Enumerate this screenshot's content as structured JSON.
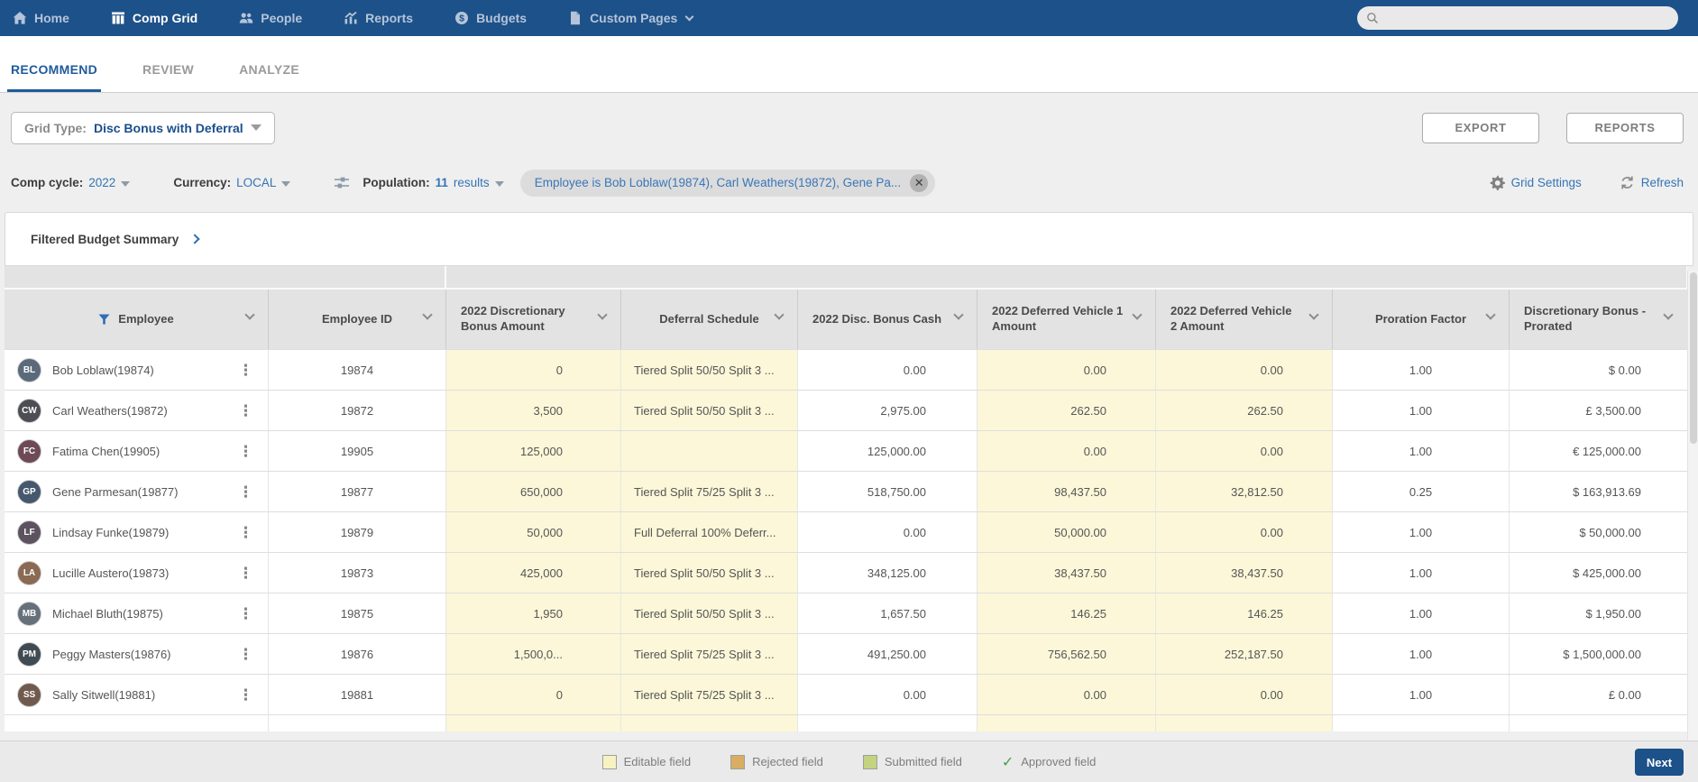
{
  "colors": {
    "nav_bg": "#1d5189",
    "accent_blue": "#3474b5",
    "active_tab": "#1f5b9d",
    "editable_cell": "#fbf7d8",
    "editable_swatch": "#f7f2c2",
    "rejected_swatch": "#d9ad62",
    "submitted_swatch": "#c3d37f",
    "approved_check": "#43a047",
    "next_btn": "#1d5189"
  },
  "nav": {
    "items": [
      {
        "label": "Home",
        "icon": "home-icon",
        "active": false
      },
      {
        "label": "Comp Grid",
        "icon": "comp-grid-icon",
        "active": true
      },
      {
        "label": "People",
        "icon": "people-icon",
        "active": false
      },
      {
        "label": "Reports",
        "icon": "reports-icon",
        "active": false
      },
      {
        "label": "Budgets",
        "icon": "budgets-icon",
        "active": false
      },
      {
        "label": "Custom Pages",
        "icon": "custom-pages-icon",
        "active": false,
        "dropdown": true
      }
    ],
    "search_value": ""
  },
  "tabs": [
    {
      "label": "RECOMMEND",
      "active": true
    },
    {
      "label": "REVIEW",
      "active": false
    },
    {
      "label": "ANALYZE",
      "active": false
    }
  ],
  "toolbar": {
    "grid_type_label": "Grid Type:",
    "grid_type_value": "Disc Bonus with Deferral",
    "export_label": "EXPORT",
    "reports_label": "REPORTS"
  },
  "filters": {
    "comp_cycle_label": "Comp cycle:",
    "comp_cycle_value": "2022",
    "currency_label": "Currency:",
    "currency_value": "LOCAL",
    "population_label": "Population:",
    "population_count": "11",
    "population_unit": "results",
    "filter_chip": "Employee is Bob Loblaw(19874), Carl Weathers(19872), Gene Pa...",
    "grid_settings_label": "Grid Settings",
    "refresh_label": "Refresh"
  },
  "summary": {
    "title": "Filtered Budget Summary"
  },
  "table": {
    "columns": [
      {
        "key": "name",
        "label": "Employee",
        "filter": true
      },
      {
        "key": "id",
        "label": "Employee ID"
      },
      {
        "key": "bonus",
        "label": "2022 Discretionary Bonus Amount"
      },
      {
        "key": "deferral",
        "label": "Deferral Schedule"
      },
      {
        "key": "cash",
        "label": "2022 Disc. Bonus Cash"
      },
      {
        "key": "v1",
        "label": "2022 Deferred Vehicle 1 Amount"
      },
      {
        "key": "v2",
        "label": "2022 Deferred Vehicle 2 Amount"
      },
      {
        "key": "proration",
        "label": "Proration Factor"
      },
      {
        "key": "prorated",
        "label": "Discretionary Bonus - Prorated"
      }
    ],
    "rows": [
      {
        "name": "Bob Loblaw(19874)",
        "initials": "BL",
        "avatar_color": "#5a6a7a",
        "id": "19874",
        "bonus": "0",
        "deferral": "Tiered Split 50/50 Split 3 ...",
        "cash": "0.00",
        "v1": "0.00",
        "v2": "0.00",
        "proration": "1.00",
        "prorated": "$ 0.00"
      },
      {
        "name": "Carl Weathers(19872)",
        "initials": "CW",
        "avatar_color": "#4d4d55",
        "id": "19872",
        "bonus": "3,500",
        "deferral": "Tiered Split 50/50 Split 3 ...",
        "cash": "2,975.00",
        "v1": "262.50",
        "v2": "262.50",
        "proration": "1.00",
        "prorated": "£ 3,500.00"
      },
      {
        "name": "Fatima Chen(19905)",
        "initials": "FC",
        "avatar_color": "#6d4a56",
        "id": "19905",
        "bonus": "125,000",
        "deferral": "",
        "cash": "125,000.00",
        "v1": "0.00",
        "v2": "0.00",
        "proration": "1.00",
        "prorated": "€ 125,000.00"
      },
      {
        "name": "Gene Parmesan(19877)",
        "initials": "GP",
        "avatar_color": "#46586e",
        "id": "19877",
        "bonus": "650,000",
        "deferral": "Tiered Split 75/25 Split 3 ...",
        "cash": "518,750.00",
        "v1": "98,437.50",
        "v2": "32,812.50",
        "proration": "0.25",
        "prorated": "$ 163,913.69"
      },
      {
        "name": "Lindsay Funke(19879)",
        "initials": "LF",
        "avatar_color": "#5d5360",
        "id": "19879",
        "bonus": "50,000",
        "deferral": "Full Deferral 100% Deferr...",
        "cash": "0.00",
        "v1": "50,000.00",
        "v2": "0.00",
        "proration": "1.00",
        "prorated": "$ 50,000.00"
      },
      {
        "name": "Lucille Austero(19873)",
        "initials": "LA",
        "avatar_color": "#8a6a52",
        "id": "19873",
        "bonus": "425,000",
        "deferral": "Tiered Split 50/50 Split 3 ...",
        "cash": "348,125.00",
        "v1": "38,437.50",
        "v2": "38,437.50",
        "proration": "1.00",
        "prorated": "$ 425,000.00"
      },
      {
        "name": "Michael Bluth(19875)",
        "initials": "MB",
        "avatar_color": "#66707a",
        "id": "19875",
        "bonus": "1,950",
        "deferral": "Tiered Split 50/50 Split 3 ...",
        "cash": "1,657.50",
        "v1": "146.25",
        "v2": "146.25",
        "proration": "1.00",
        "prorated": "$ 1,950.00"
      },
      {
        "name": "Peggy Masters(19876)",
        "initials": "PM",
        "avatar_color": "#3f4a52",
        "id": "19876",
        "bonus": "1,500,0...",
        "deferral": "Tiered Split 75/25 Split 3 ...",
        "cash": "491,250.00",
        "v1": "756,562.50",
        "v2": "252,187.50",
        "proration": "1.00",
        "prorated": "$ 1,500,000.00"
      },
      {
        "name": "Sally Sitwell(19881)",
        "initials": "SS",
        "avatar_color": "#705a4e",
        "id": "19881",
        "bonus": "0",
        "deferral": "Tiered Split 75/25 Split 3 ...",
        "cash": "0.00",
        "v1": "0.00",
        "v2": "0.00",
        "proration": "1.00",
        "prorated": "£ 0.00"
      }
    ]
  },
  "legend": {
    "items": [
      {
        "label": "Editable field",
        "swatch": "#f7f2c2"
      },
      {
        "label": "Rejected field",
        "swatch": "#d9ad62"
      },
      {
        "label": "Submitted field",
        "swatch": "#c3d37f"
      },
      {
        "label": "Approved field",
        "swatch": "check"
      }
    ]
  },
  "footer": {
    "next_label": "Next"
  }
}
